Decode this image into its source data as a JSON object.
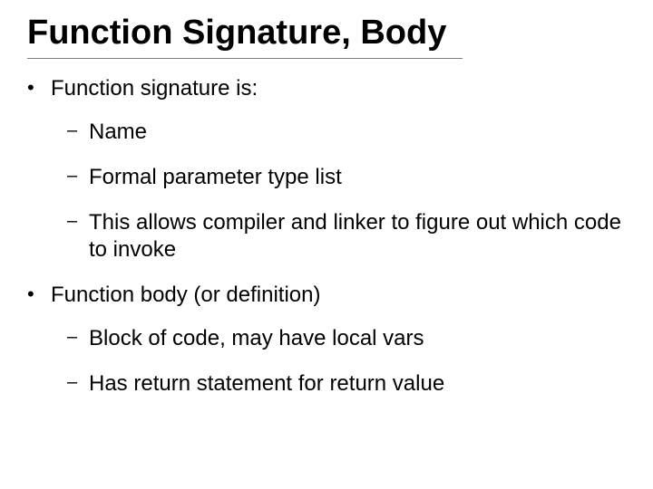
{
  "title": "Function Signature, Body",
  "bullets": [
    {
      "text": "Function signature is:",
      "sub": [
        {
          "text": "Name"
        },
        {
          "text": "Formal parameter type list"
        },
        {
          "text": "This allows compiler and linker to figure out which code to invoke"
        }
      ]
    },
    {
      "text": "Function body (or definition)",
      "sub": [
        {
          "text": "Block of code, may have local vars"
        },
        {
          "text": "Has return statement for return value"
        }
      ]
    }
  ]
}
